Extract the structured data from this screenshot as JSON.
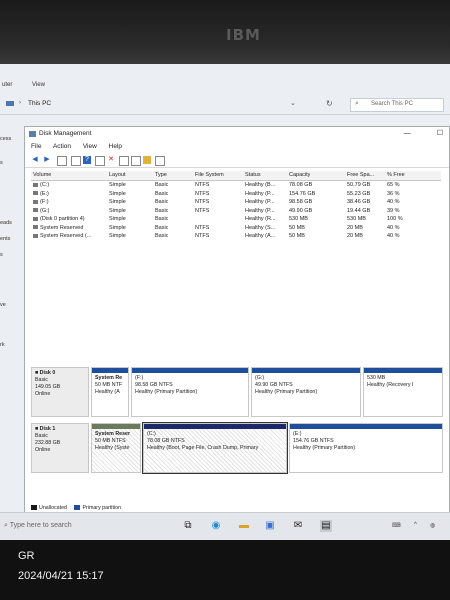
{
  "bezel": {
    "logo": "IBM"
  },
  "explorer": {
    "ribbon_items": [
      "uter",
      "View"
    ],
    "address": "This PC",
    "search_placeholder": "Search This PC",
    "nav_items": [
      "cess",
      "s",
      "eads",
      "ents",
      "s",
      "ve",
      "rk"
    ]
  },
  "disk_management": {
    "title": "Disk Management",
    "menu": [
      "File",
      "Action",
      "View",
      "Help"
    ],
    "columns": [
      "Volume",
      "Layout",
      "Type",
      "File System",
      "Status",
      "Capacity",
      "Free Spa...",
      "% Free"
    ],
    "volumes": [
      {
        "volume": "(C:)",
        "layout": "Simple",
        "type": "Basic",
        "fs": "NTFS",
        "status": "Healthy (B...",
        "capacity": "78.08 GB",
        "free": "50.79 GB",
        "pct": "65 %"
      },
      {
        "volume": "(E:)",
        "layout": "Simple",
        "type": "Basic",
        "fs": "NTFS",
        "status": "Healthy (P...",
        "capacity": "154.76 GB",
        "free": "55.23 GB",
        "pct": "36 %"
      },
      {
        "volume": "(F:)",
        "layout": "Simple",
        "type": "Basic",
        "fs": "NTFS",
        "status": "Healthy (P...",
        "capacity": "98.58 GB",
        "free": "38.46 GB",
        "pct": "40 %"
      },
      {
        "volume": "(G:)",
        "layout": "Simple",
        "type": "Basic",
        "fs": "NTFS",
        "status": "Healthy (P...",
        "capacity": "49.90 GB",
        "free": "19.44 GB",
        "pct": "39 %"
      },
      {
        "volume": "(Disk 0 partition 4)",
        "layout": "Simple",
        "type": "Basic",
        "fs": "",
        "status": "Healthy (R...",
        "capacity": "530 MB",
        "free": "530 MB",
        "pct": "100 %"
      },
      {
        "volume": "System Reserved",
        "layout": "Simple",
        "type": "Basic",
        "fs": "NTFS",
        "status": "Healthy (S...",
        "capacity": "50 MB",
        "free": "20 MB",
        "pct": "40 %"
      },
      {
        "volume": "System Reserved (...",
        "layout": "Simple",
        "type": "Basic",
        "fs": "NTFS",
        "status": "Healthy (A...",
        "capacity": "50 MB",
        "free": "20 MB",
        "pct": "40 %"
      }
    ],
    "disks": [
      {
        "name": "Disk 0",
        "type": "Basic",
        "size": "149.05 GB",
        "state": "Online",
        "partitions": [
          {
            "name": "System Re",
            "size": "50 MB NTF",
            "status": "Healthy (A"
          },
          {
            "name": "(F:)",
            "size": "98.58 GB NTFS",
            "status": "Healthy (Primary Partition)"
          },
          {
            "name": "(G:)",
            "size": "49.90 GB NTFS",
            "status": "Healthy (Primary Partition)"
          },
          {
            "name": "",
            "size": "530 MB",
            "status": "Healthy (Recovery I"
          }
        ]
      },
      {
        "name": "Disk 1",
        "type": "Basic",
        "size": "232.88 GB",
        "state": "Online",
        "partitions": [
          {
            "name": "System Reser",
            "size": "50 MB NTFS",
            "status": "Healthy (Syste"
          },
          {
            "name": "(C:)",
            "size": "78.08 GB NTFS",
            "status": "Healthy (Boot, Page File, Crash Dump, Primary"
          },
          {
            "name": "(E:)",
            "size": "154.76 GB NTFS",
            "status": "Healthy (Primary Partition)"
          }
        ]
      }
    ],
    "legend": [
      "Unallocated",
      "Primary partition"
    ]
  },
  "taskbar": {
    "search_placeholder": "Type here to search"
  },
  "photo": {
    "tag": "GR",
    "timestamp": "2024/04/21 15:17"
  },
  "colors": {
    "primary_partition": "#1f4e9c",
    "unallocated": "#1a1a1a",
    "window_bg": "#ffffff"
  }
}
